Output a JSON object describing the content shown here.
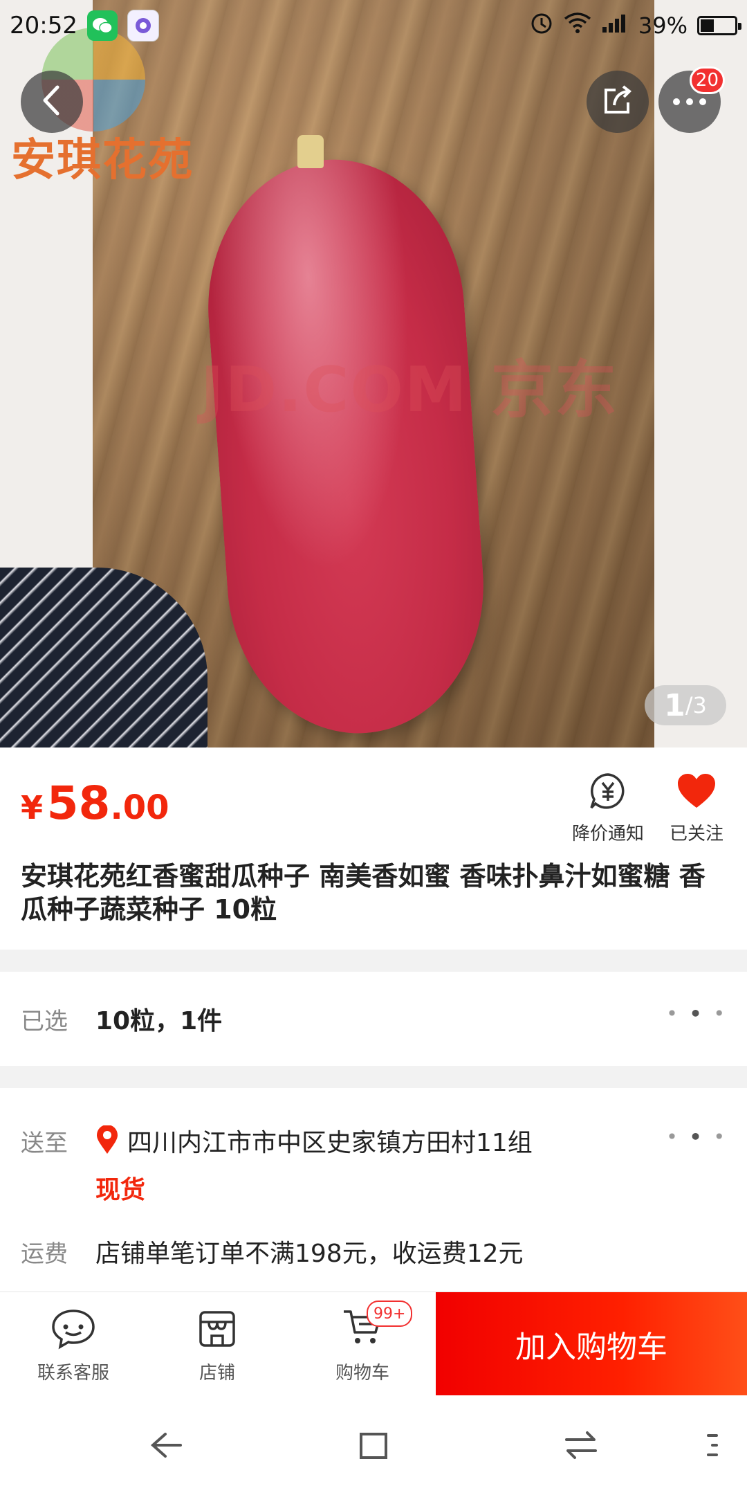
{
  "status_bar": {
    "time": "20:52",
    "battery": "39%",
    "battery_level": 0.39
  },
  "hero": {
    "brand_logo_text": "安琪花苑",
    "watermark": "JD.COM 京东",
    "page_counter": {
      "current": "1",
      "total": "/3"
    },
    "more_badge": "20"
  },
  "product": {
    "price": {
      "symbol": "¥",
      "integer": "58",
      "decimal": ".00"
    },
    "price_alert_label": "降价通知",
    "follow_label": "已关注",
    "title": "安琪花苑红香蜜甜瓜种子 南美香如蜜 香味扑鼻汁如蜜糖 香瓜种子蔬菜种子 10粒"
  },
  "selection": {
    "label": "已选",
    "value": "10粒，1件"
  },
  "shipping": {
    "label": "送至",
    "address": "四川内江市市中区史家镇方田村11组",
    "stock": "现货",
    "fee_label": "运费",
    "fee_value": "店铺单笔订单不满198元，收运费12元"
  },
  "bottom_bar": {
    "service_label": "联系客服",
    "store_label": "店铺",
    "cart_label": "购物车",
    "cart_badge": "99+",
    "add_to_cart": "加入购物车"
  },
  "colors": {
    "accent_red": "#f2270c",
    "cart_button": "#f10000"
  }
}
